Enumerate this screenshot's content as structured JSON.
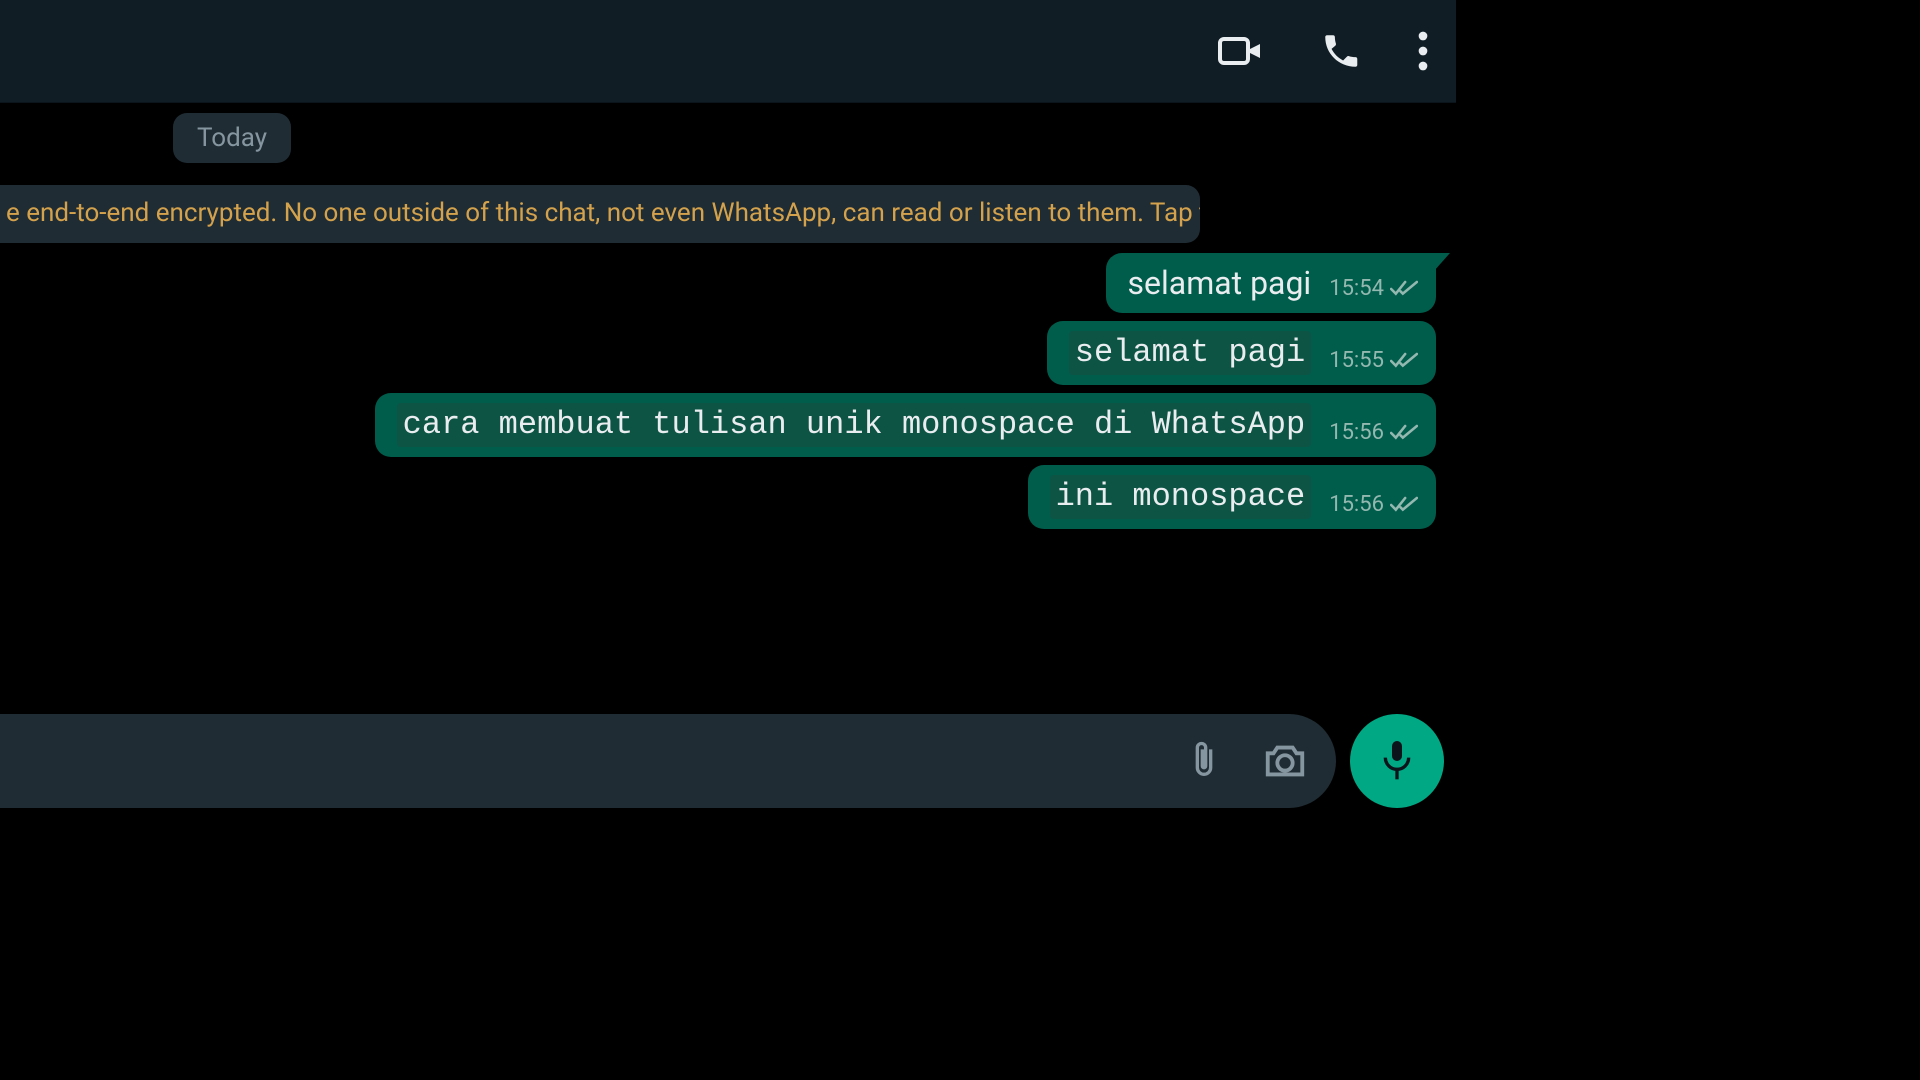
{
  "date_label": "Today",
  "encryption_notice": "e end-to-end encrypted. No one outside of this chat, not even WhatsApp, can read or listen to them. Tap to learn more.",
  "messages": [
    {
      "text": "selamat pagi",
      "time": "15:54",
      "mono": false,
      "tail": true
    },
    {
      "text": "selamat pagi",
      "time": "15:55",
      "mono": true,
      "tail": false
    },
    {
      "text": "cara membuat tulisan unik monospace di WhatsApp",
      "time": "15:56",
      "mono": true,
      "tail": false
    },
    {
      "text": "ini monospace",
      "time": "15:56",
      "mono": true,
      "tail": false
    }
  ]
}
